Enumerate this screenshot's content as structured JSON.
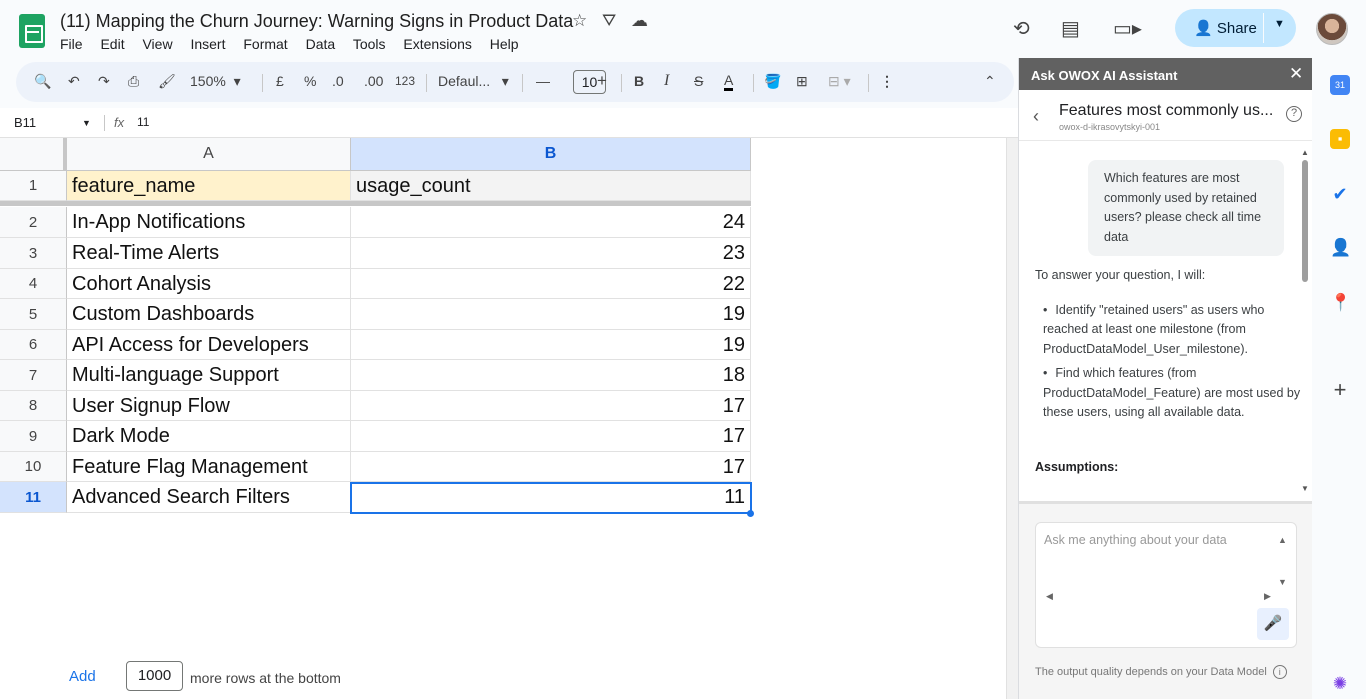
{
  "doc": {
    "title": "(11) Mapping the Churn Journey: Warning Signs in Product Data",
    "menu": [
      "File",
      "Edit",
      "View",
      "Insert",
      "Format",
      "Data",
      "Tools",
      "Extensions",
      "Help"
    ],
    "share_label": "Share"
  },
  "toolbar": {
    "zoom": "150%",
    "currency": "£",
    "percent": "%",
    "dec_decrease": ".0",
    "dec_increase": ".00",
    "number_format": "123",
    "font": "Defaul...",
    "font_size": "10",
    "bold": "B",
    "italic": "I",
    "strike": "S",
    "text_color": "A"
  },
  "formula_bar": {
    "cell_ref": "B11",
    "fx": "fx",
    "value": "11"
  },
  "sheet": {
    "columns": [
      "A",
      "B"
    ],
    "header_row": {
      "num": "1",
      "a": "feature_name",
      "b": "usage_count"
    },
    "rows": [
      {
        "num": "2",
        "a": "In-App Notifications",
        "b": "24"
      },
      {
        "num": "3",
        "a": "Real-Time Alerts",
        "b": "23"
      },
      {
        "num": "4",
        "a": "Cohort Analysis",
        "b": "22"
      },
      {
        "num": "5",
        "a": "Custom Dashboards",
        "b": "19"
      },
      {
        "num": "6",
        "a": "API Access for Developers",
        "b": "19"
      },
      {
        "num": "7",
        "a": "Multi-language Support",
        "b": "18"
      },
      {
        "num": "8",
        "a": "User Signup Flow",
        "b": "17"
      },
      {
        "num": "9",
        "a": "Dark Mode",
        "b": "17"
      },
      {
        "num": "10",
        "a": "Feature Flag Management",
        "b": "17"
      },
      {
        "num": "11",
        "a": "Advanced Search Filters",
        "b": "11"
      }
    ],
    "selected_cell": "B11",
    "add_label": "Add",
    "add_rows_value": "1000",
    "add_rows_suffix": "more rows at the bottom"
  },
  "panel": {
    "header": "Ask OWOX AI Assistant",
    "conversation_title": "Features most commonly us...",
    "conversation_subtitle": "owox-d-ikrasovytskyi-001",
    "user_message": "Which features are most commonly used by retained users? please check all time data",
    "answer_intro": "To answer your question, I will:",
    "answer_steps": [
      "Identify \"retained users\" as users who reached at least one milestone (from ProductDataModel_User_milestone).",
      "Find which features (from ProductDataModel_Feature) are most used by these users, using all available data."
    ],
    "assumptions_label": "Assumptions:",
    "input_placeholder": "Ask me anything about your data",
    "footer_note": "The output quality depends on your Data Model"
  },
  "colors": {
    "accent": "#1a73e8",
    "share_bg": "#c2e7ff",
    "header_cell_bg": "#fff2cc",
    "panel_header_bg": "#616161",
    "sheets_green": "#1ea362"
  }
}
